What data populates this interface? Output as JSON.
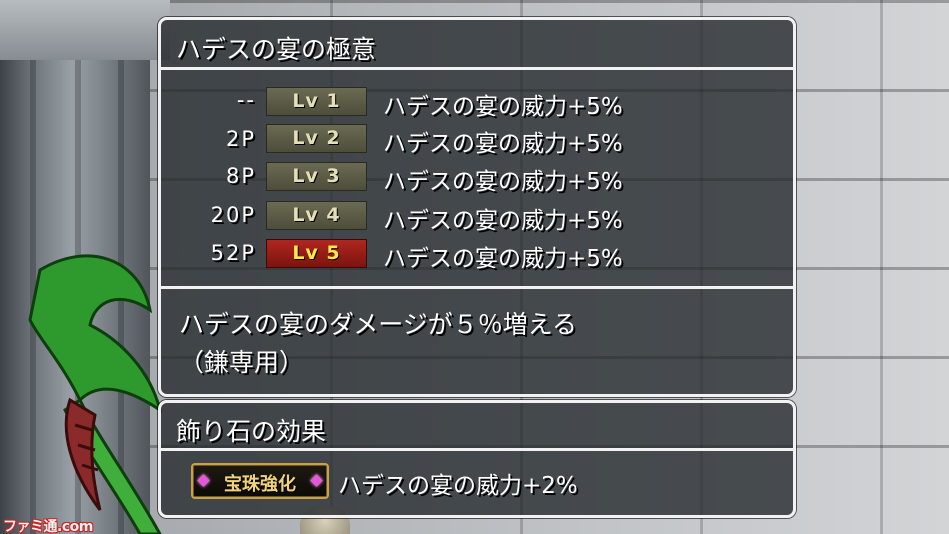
{
  "skill_window": {
    "title": "ハデスの宴の極意",
    "levels": [
      {
        "cost": "--",
        "level": "Lv 1",
        "effect": "ハデスの宴の威力+5%",
        "selected": false
      },
      {
        "cost": "2P",
        "level": "Lv 2",
        "effect": "ハデスの宴の威力+5%",
        "selected": false
      },
      {
        "cost": "8P",
        "level": "Lv 3",
        "effect": "ハデスの宴の威力+5%",
        "selected": false
      },
      {
        "cost": "20P",
        "level": "Lv 4",
        "effect": "ハデスの宴の威力+5%",
        "selected": false
      },
      {
        "cost": "52P",
        "level": "Lv 5",
        "effect": "ハデスの宴の威力+5%",
        "selected": true
      }
    ],
    "description_line1": "ハデスの宴のダメージが５％増える",
    "description_line2": "（鎌専用）"
  },
  "jewel_window": {
    "title": "飾り石の効果",
    "badge_label": "宝珠強化",
    "effect": "ハデスの宴の威力+2%"
  },
  "watermark": "ファミ通.com",
  "colors": {
    "panel_bg": "#262a2e",
    "panel_border": "#f2f2f2",
    "level_chip": "#5c5b45",
    "level_chip_active": "#9e1f18",
    "level_text_active": "#ffe84a",
    "badge_border": "#c9a14b",
    "badge_gem": "#e05ad6"
  }
}
